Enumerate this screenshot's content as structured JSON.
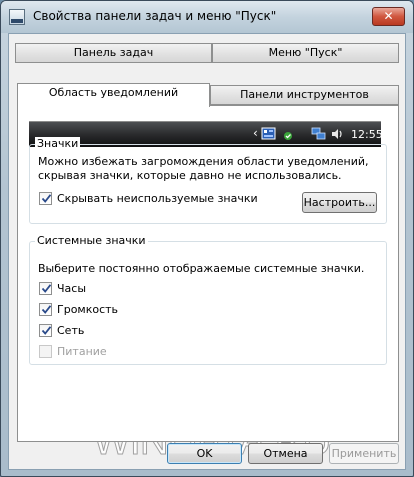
{
  "window": {
    "title": "Свойства панели задач и меню \"Пуск\"",
    "close_glyph": "✕"
  },
  "tabs": [
    {
      "label": "Панель задач",
      "active": false
    },
    {
      "label": "Меню \"Пуск\"",
      "active": false
    },
    {
      "label": "Область уведомлений",
      "active": true
    },
    {
      "label": "Панели инструментов",
      "active": false
    }
  ],
  "taskbar_preview": {
    "chevron": "‹",
    "clock": "12:55",
    "icons": [
      "keyboard-layout-icon",
      "network-icon",
      "volume-icon"
    ]
  },
  "icons_group": {
    "legend": "Значки",
    "description": "Можно избежать загромождения области уведомлений, скрывая значки, которые давно не использовались.",
    "hide_inactive": {
      "label": "Скрывать неиспользуемые значки",
      "checked": true
    },
    "customize_button": "Настроить..."
  },
  "system_icons_group": {
    "legend": "Системные значки",
    "description": "Выберите постоянно отображаемые системные значки.",
    "items": [
      {
        "label": "Часы",
        "checked": true,
        "enabled": true
      },
      {
        "label": "Громкость",
        "checked": true,
        "enabled": true
      },
      {
        "label": "Сеть",
        "checked": true,
        "enabled": true
      },
      {
        "label": "Питание",
        "checked": false,
        "enabled": false
      }
    ]
  },
  "buttons": {
    "ok": "OK",
    "cancel": "Отмена",
    "apply": "Применить"
  },
  "watermark": "WINDATA.RU",
  "colors": {
    "accent": "#3c7fb1",
    "taskbar": "#1c1d1f",
    "close": "#c94a33"
  }
}
